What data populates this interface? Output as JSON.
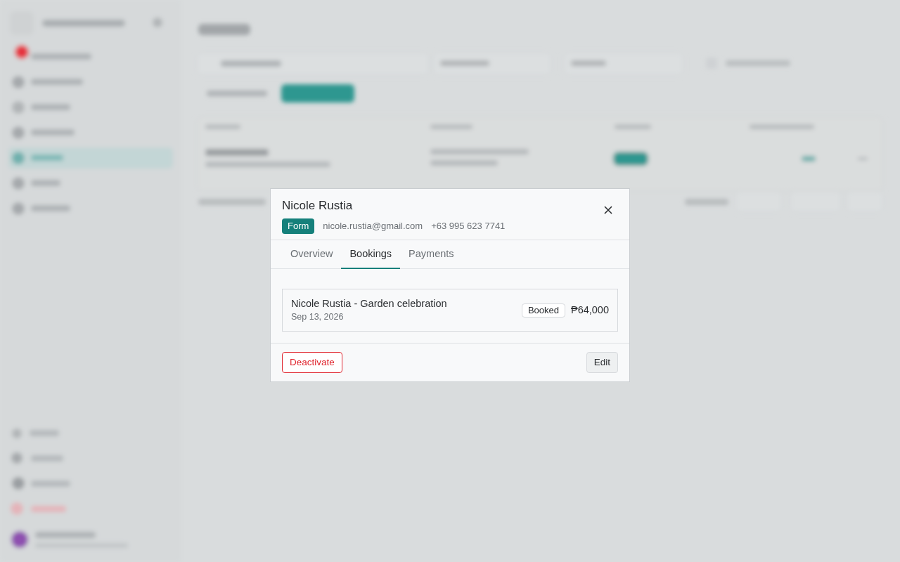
{
  "dialog": {
    "title": "Nicole Rustia",
    "source": "Form",
    "email": "nicole.rustia@gmail.com",
    "phone": "+63 995 623 7741",
    "tabs": [
      {
        "label": "Overview",
        "selected": false
      },
      {
        "label": "Bookings",
        "selected": true
      },
      {
        "label": "Payments",
        "selected": false
      }
    ],
    "bookings": [
      {
        "title": "Nicole Rustia - Garden celebration",
        "date": "Sep 13, 2026",
        "status": "Booked",
        "amount": "₱64,000"
      }
    ],
    "buttons": [
      {
        "kind": "danger",
        "label": "Deactivate"
      },
      {
        "kind": "secondary",
        "label": "Edit"
      }
    ]
  }
}
